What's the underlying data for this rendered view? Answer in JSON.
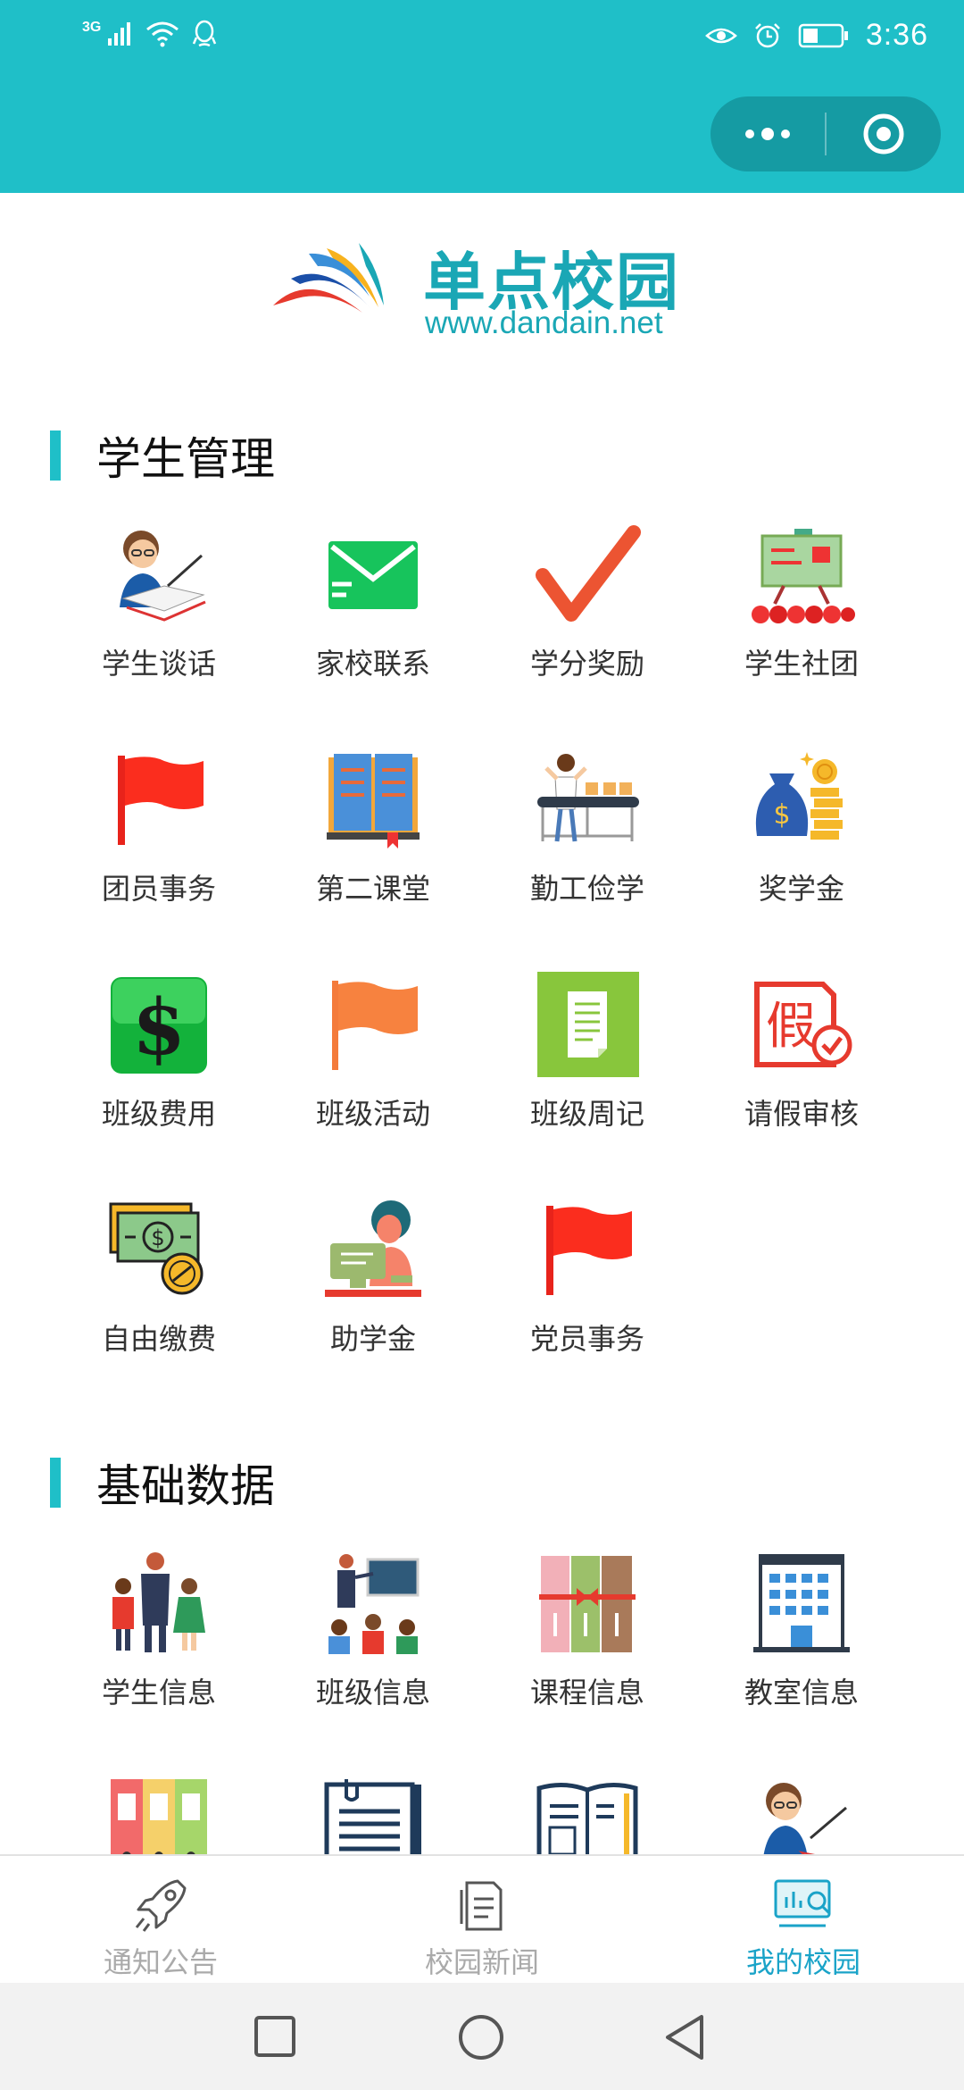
{
  "status_bar": {
    "network": "3G",
    "time": "3:36"
  },
  "logo": {
    "title": "单点校园",
    "url": "www.dandain.net"
  },
  "sections": [
    {
      "title": "学生管理",
      "items": [
        {
          "label": "学生谈话",
          "icon": "teacher-talk-icon"
        },
        {
          "label": "家校联系",
          "icon": "envelope-icon"
        },
        {
          "label": "学分奖励",
          "icon": "checkmark-icon"
        },
        {
          "label": "学生社团",
          "icon": "club-board-icon"
        },
        {
          "label": "团员事务",
          "icon": "red-flag-icon"
        },
        {
          "label": "第二课堂",
          "icon": "open-book-icon"
        },
        {
          "label": "勤工俭学",
          "icon": "conveyor-worker-icon"
        },
        {
          "label": "奖学金",
          "icon": "money-bag-icon"
        },
        {
          "label": "班级费用",
          "icon": "dollar-icon"
        },
        {
          "label": "班级活动",
          "icon": "orange-flag-icon"
        },
        {
          "label": "班级周记",
          "icon": "notebook-icon"
        },
        {
          "label": "请假审核",
          "icon": "leave-approval-icon"
        },
        {
          "label": "自由缴费",
          "icon": "cash-coin-icon"
        },
        {
          "label": "助学金",
          "icon": "study-desk-icon"
        },
        {
          "label": "党员事务",
          "icon": "party-flag-icon"
        }
      ]
    },
    {
      "title": "基础数据",
      "items": [
        {
          "label": "学生信息",
          "icon": "students-group-icon"
        },
        {
          "label": "班级信息",
          "icon": "classroom-icon"
        },
        {
          "label": "课程信息",
          "icon": "books-icon"
        },
        {
          "label": "教室信息",
          "icon": "building-icon"
        },
        {
          "label": "",
          "icon": "folders-icon"
        },
        {
          "label": "",
          "icon": "clipboard-icon"
        },
        {
          "label": "",
          "icon": "report-icon"
        },
        {
          "label": "",
          "icon": "teacher-icon"
        }
      ]
    }
  ],
  "tabbar": {
    "tabs": [
      {
        "label": "通知公告",
        "icon": "rocket-icon",
        "active": false
      },
      {
        "label": "校园新闻",
        "icon": "document-icon",
        "active": false
      },
      {
        "label": "我的校园",
        "icon": "dashboard-icon",
        "active": true
      }
    ]
  },
  "colors": {
    "brand": "#1fbfc8",
    "tab_active": "#1aa3c8",
    "tab_inactive": "#aaaaaa"
  }
}
